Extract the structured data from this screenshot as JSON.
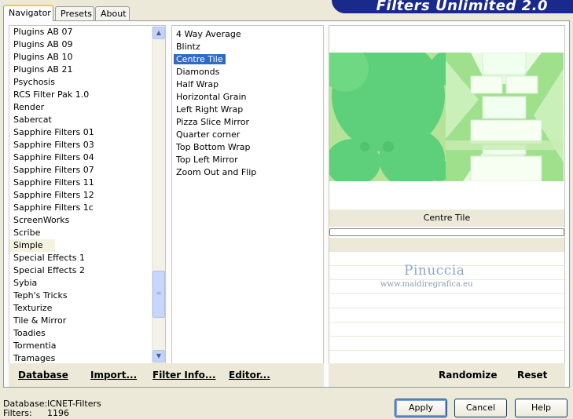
{
  "tabs": [
    "Navigator",
    "Presets",
    "About"
  ],
  "banner_title": "Filters Unlimited 2.0",
  "categories": [
    "Plugins AB 07",
    "Plugins AB 09",
    "Plugins AB 10",
    "Plugins AB 21",
    "Psychosis",
    "RCS Filter Pak 1.0",
    "Render",
    "Sabercat",
    "Sapphire Filters 01",
    "Sapphire Filters 03",
    "Sapphire Filters 04",
    "Sapphire Filters 07",
    "Sapphire Filters 11",
    "Sapphire Filters 12",
    "Sapphire Filters 1c",
    "ScreenWorks",
    "Scribe",
    "Simple",
    "Special Effects 1",
    "Special Effects 2",
    "Sybia",
    "Teph's Tricks",
    "Texturize",
    "Tile & Mirror",
    "Toadies",
    "Tormentia",
    "Tramages"
  ],
  "selected_category": "Simple",
  "filters": [
    "4 Way Average",
    "Blintz",
    "Centre Tile",
    "Diamonds",
    "Half Wrap",
    "Horizontal Grain",
    "Left Right Wrap",
    "Pizza Slice Mirror",
    "Quarter corner",
    "Top Bottom Wrap",
    "Top Left Mirror",
    "Zoom Out and Flip"
  ],
  "selected_filter": "Centre Tile",
  "filter_title": "Centre Tile",
  "watermark": {
    "name": "Pinuccia",
    "url": "www.maidiregrafica.eu"
  },
  "left_bar": {
    "database": "Database",
    "import": "Import...",
    "filter_info": "Filter Info...",
    "editor": "Editor..."
  },
  "right_bar": {
    "randomize": "Randomize",
    "reset": "Reset"
  },
  "status": {
    "database_label": "Database:",
    "database_value": "ICNET-Filters",
    "filters_label": "Filters:",
    "filters_value": "1196"
  },
  "buttons": {
    "apply": "Apply",
    "cancel": "Cancel",
    "help": "Help"
  },
  "colors": {
    "selection": "#316ac5",
    "banner": "#1a2a8c",
    "preview_green": "#5ecf7a",
    "preview_light": "#b6e39a"
  }
}
